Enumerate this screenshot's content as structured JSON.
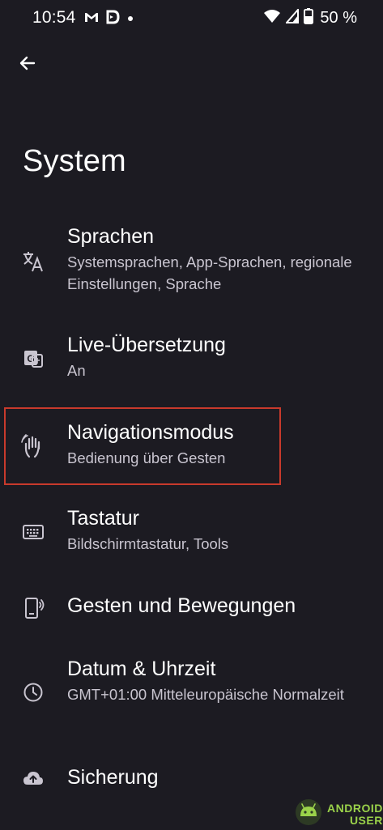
{
  "status_bar": {
    "time": "10:54",
    "notification_icons": [
      "gmail-icon",
      "drive-icon",
      "dot-icon"
    ],
    "status_icons": [
      "wifi-icon",
      "cellular-icon",
      "battery-icon"
    ],
    "battery": "50 %"
  },
  "header": {
    "back_icon": "arrow-back-icon",
    "title": "System"
  },
  "items": [
    {
      "icon": "translate-icon",
      "title": "Sprachen",
      "subtitle": "Systemsprachen, App-Sprachen, regionale Einstellungen, Sprache"
    },
    {
      "icon": "live-translate-icon",
      "title": "Live-Übersetzung",
      "subtitle": "An"
    },
    {
      "icon": "gesture-hand-icon",
      "title": "Navigationsmodus",
      "subtitle": "Bedienung über Gesten",
      "highlighted": true
    },
    {
      "icon": "keyboard-icon",
      "title": "Tastatur",
      "subtitle": "Bildschirmtastatur, Tools"
    },
    {
      "icon": "phone-gesture-icon",
      "title": "Gesten und Bewegungen",
      "subtitle": ""
    },
    {
      "icon": "clock-icon",
      "title": "Datum & Uhrzeit",
      "subtitle": "GMT+01:00 Mitteleuropäische Normalzeit"
    },
    {
      "icon": "cloud-upload-icon",
      "title": "Sicherung",
      "subtitle": ""
    }
  ],
  "highlight_color": "#c83a2c",
  "watermark": {
    "line1": "ANDROID",
    "line2": "USER",
    "color": "#9ad24a"
  }
}
